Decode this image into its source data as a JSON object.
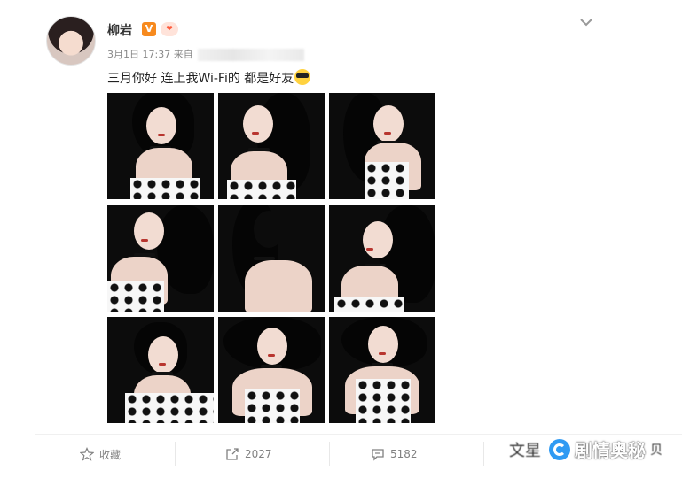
{
  "post": {
    "author": "柳岩",
    "badge_v": "V",
    "badge_vip": "❤",
    "date": "3月1日 17:37",
    "source_prefix": "来自",
    "text": "三月你好 连上我Wi-Fi的 都是好友",
    "emoji": "cool-sunglasses-emoji"
  },
  "photos": [
    {
      "label": "photo-1"
    },
    {
      "label": "photo-2"
    },
    {
      "label": "photo-3"
    },
    {
      "label": "photo-4"
    },
    {
      "label": "photo-5"
    },
    {
      "label": "photo-6"
    },
    {
      "label": "photo-7"
    },
    {
      "label": "photo-8"
    },
    {
      "label": "photo-9"
    }
  ],
  "actions": {
    "favorite_label": "收藏",
    "repost_count": "2027",
    "comment_count": "5182"
  },
  "watermark": {
    "prefix": "文星",
    "text": "剧情奥秘",
    "suffix": "贝"
  },
  "colors": {
    "accent_orange": "#f78a1e",
    "text_gray": "#808080",
    "watermark_blue": "#2f9af3"
  }
}
